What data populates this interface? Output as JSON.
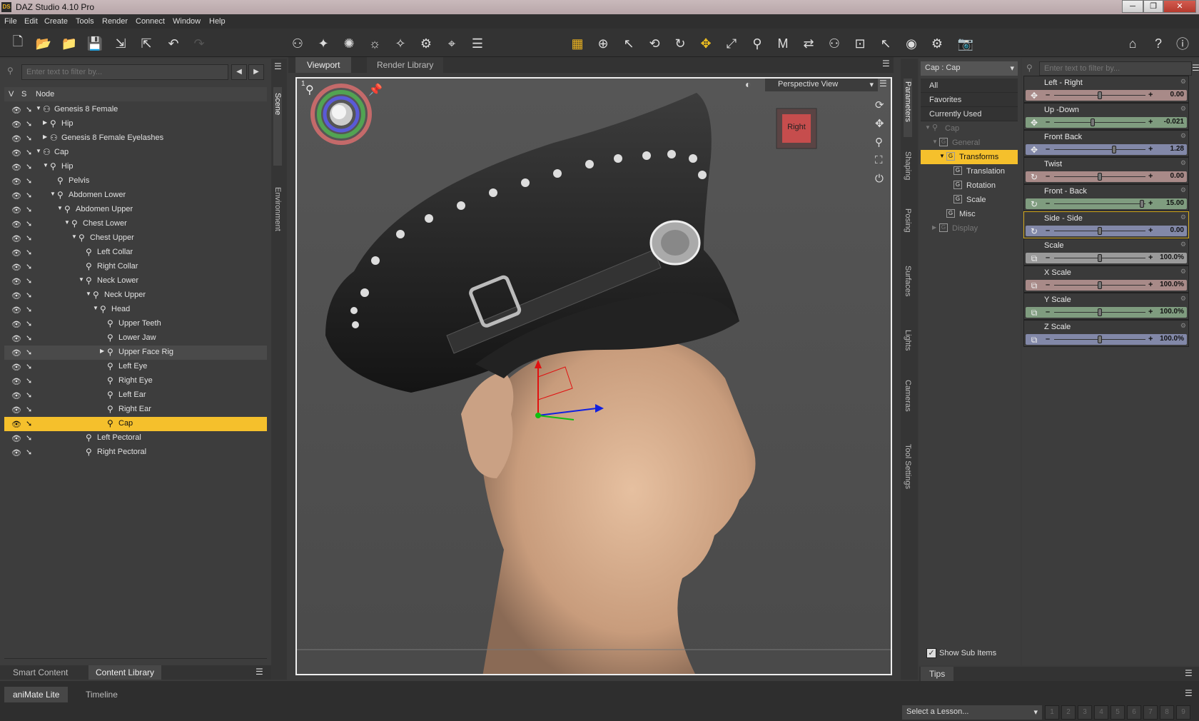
{
  "app": {
    "title": "DAZ Studio 4.10 Pro",
    "icon": "DS"
  },
  "menu": [
    "File",
    "Edit",
    "Create",
    "Tools",
    "Render",
    "Connect",
    "Window",
    "Help"
  ],
  "window_controls": {
    "minimize": "─",
    "restore": "❐",
    "close": "✕"
  },
  "toolbar": {
    "left": [
      "new-file-icon",
      "open-file-icon",
      "open-recent-icon",
      "save-icon",
      "import-icon",
      "export-icon",
      "undo-icon",
      "redo-icon"
    ],
    "center": [
      "☐",
      "⊕",
      "↖",
      "⟲",
      "↻",
      "✥",
      "⤢",
      "⚲",
      "M",
      "⇄",
      "⚇",
      "⊡"
    ]
  },
  "left_panel": {
    "filter_placeholder": "Enter text to filter by...",
    "col_v": "V",
    "col_s": "S",
    "col_node": "Node",
    "tree": [
      {
        "label": "Genesis 8 Female",
        "depth": 0,
        "tw": "▼",
        "icon": "figure"
      },
      {
        "label": "Hip",
        "depth": 1,
        "tw": "▶",
        "icon": "bone"
      },
      {
        "label": "Genesis 8 Female Eyelashes",
        "depth": 1,
        "tw": "▶",
        "icon": "figure"
      },
      {
        "label": "Cap",
        "depth": 0,
        "tw": "▼",
        "icon": "figure"
      },
      {
        "label": "Hip",
        "depth": 1,
        "tw": "▼",
        "icon": "bone"
      },
      {
        "label": "Pelvis",
        "depth": 2,
        "tw": "",
        "icon": "bone"
      },
      {
        "label": "Abdomen Lower",
        "depth": 2,
        "tw": "▼",
        "icon": "bone"
      },
      {
        "label": "Abdomen Upper",
        "depth": 3,
        "tw": "▼",
        "icon": "bone"
      },
      {
        "label": "Chest Lower",
        "depth": 4,
        "tw": "▼",
        "icon": "bone"
      },
      {
        "label": "Chest Upper",
        "depth": 5,
        "tw": "▼",
        "icon": "bone"
      },
      {
        "label": "Left Collar",
        "depth": 6,
        "tw": "",
        "icon": "bone"
      },
      {
        "label": "Right Collar",
        "depth": 6,
        "tw": "",
        "icon": "bone"
      },
      {
        "label": "Neck Lower",
        "depth": 6,
        "tw": "▼",
        "icon": "bone"
      },
      {
        "label": "Neck Upper",
        "depth": 7,
        "tw": "▼",
        "icon": "bone"
      },
      {
        "label": "Head",
        "depth": 8,
        "tw": "▼",
        "icon": "bone"
      },
      {
        "label": "Upper Teeth",
        "depth": 9,
        "tw": "",
        "icon": "bone"
      },
      {
        "label": "Lower Jaw",
        "depth": 9,
        "tw": "",
        "icon": "bone"
      },
      {
        "label": "Upper Face Rig",
        "depth": 9,
        "tw": "▶",
        "icon": "bone",
        "state": "hover"
      },
      {
        "label": "Left Eye",
        "depth": 9,
        "tw": "",
        "icon": "bone"
      },
      {
        "label": "Right Eye",
        "depth": 9,
        "tw": "",
        "icon": "bone"
      },
      {
        "label": "Left Ear",
        "depth": 9,
        "tw": "",
        "icon": "bone"
      },
      {
        "label": "Right Ear",
        "depth": 9,
        "tw": "",
        "icon": "bone"
      },
      {
        "label": "Cap",
        "depth": 9,
        "tw": "",
        "icon": "bone",
        "state": "selected"
      },
      {
        "label": "Left Pectoral",
        "depth": 6,
        "tw": "",
        "icon": "bone"
      },
      {
        "label": "Right Pectoral",
        "depth": 6,
        "tw": "",
        "icon": "bone"
      }
    ],
    "bottom_tabs": [
      "Smart Content",
      "Content Library"
    ]
  },
  "side_tabs_left": [
    "Scene",
    "Environment"
  ],
  "viewport": {
    "tabs": [
      "Viewport",
      "Render Library"
    ],
    "view_label": "Perspective View",
    "cube_label": "Right",
    "corner_num": "1"
  },
  "side_tabs_right": [
    "Parameters",
    "Shaping",
    "Posing",
    "Surfaces",
    "Lights",
    "Cameras",
    "Tool Settings"
  ],
  "params": {
    "node_select": "Cap : Cap",
    "filter_placeholder": "Enter text to filter by...",
    "groups": [
      {
        "label": "All",
        "indent": 0,
        "tw": "",
        "icon": ""
      },
      {
        "label": "Favorites",
        "indent": 0,
        "tw": "",
        "icon": ""
      },
      {
        "label": "Currently Used",
        "indent": 0,
        "tw": "",
        "icon": ""
      },
      {
        "label": "Cap",
        "indent": 0,
        "tw": "▼",
        "icon": "bone",
        "dim": true
      },
      {
        "label": "General",
        "indent": 1,
        "tw": "▼",
        "icon": "G",
        "dim": true
      },
      {
        "label": "Transforms",
        "indent": 2,
        "tw": "▼",
        "icon": "G",
        "sel": true
      },
      {
        "label": "Translation",
        "indent": 3,
        "tw": "",
        "icon": "G"
      },
      {
        "label": "Rotation",
        "indent": 3,
        "tw": "",
        "icon": "G"
      },
      {
        "label": "Scale",
        "indent": 3,
        "tw": "",
        "icon": "G"
      },
      {
        "label": "Misc",
        "indent": 2,
        "tw": "",
        "icon": "G"
      },
      {
        "label": "Display",
        "indent": 1,
        "tw": "▶",
        "icon": "G",
        "dim": true
      }
    ],
    "show_sub_items": "Show Sub Items",
    "sliders": [
      {
        "name": "Left - Right",
        "value": "0.00",
        "color": "#a88a88",
        "icon": "✥",
        "knob": 0.5
      },
      {
        "name": "Up -Down",
        "value": "-0.021",
        "color": "#7f9c7f",
        "icon": "✥",
        "knob": 0.42
      },
      {
        "name": "Front Back",
        "value": "1.28",
        "color": "#8288a8",
        "icon": "✥",
        "knob": 0.66
      },
      {
        "name": "Twist",
        "value": "0.00",
        "color": "#a88a88",
        "icon": "↻",
        "knob": 0.5
      },
      {
        "name": "Front - Back",
        "value": "15.00",
        "color": "#7f9c7f",
        "icon": "↻",
        "knob": 0.98
      },
      {
        "name": "Side - Side",
        "value": "0.00",
        "color": "#8288a8",
        "icon": "↻",
        "knob": 0.5,
        "active": true
      },
      {
        "name": "Scale",
        "value": "100.0%",
        "color": "#9a9a9a",
        "icon": "⧉",
        "knob": 0.5
      },
      {
        "name": "X Scale",
        "value": "100.0%",
        "color": "#a88a88",
        "icon": "⧉",
        "knob": 0.5
      },
      {
        "name": "Y Scale",
        "value": "100.0%",
        "color": "#7f9c7f",
        "icon": "⧉",
        "knob": 0.5
      },
      {
        "name": "Z Scale",
        "value": "100.0%",
        "color": "#8288a8",
        "icon": "⧉",
        "knob": 0.5
      }
    ],
    "tips_tab": "Tips"
  },
  "bottom": {
    "tabs": [
      "aniMate Lite",
      "Timeline"
    ],
    "lesson_select": "Select a Lesson...",
    "pages": [
      "1",
      "2",
      "3",
      "4",
      "5",
      "6",
      "7",
      "8",
      "9"
    ]
  }
}
